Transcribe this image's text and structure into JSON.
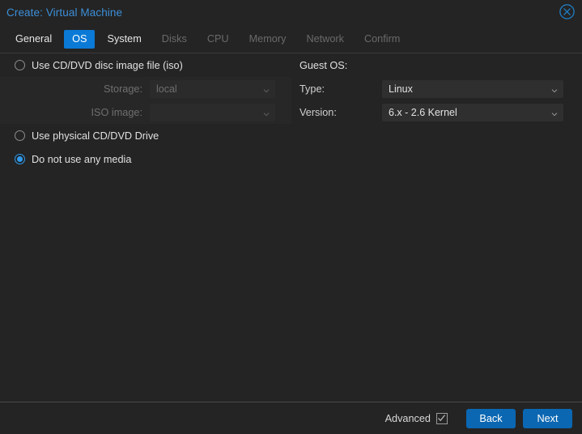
{
  "window": {
    "title": "Create: Virtual Machine",
    "close_icon": "close-circle-icon"
  },
  "tabs": [
    {
      "label": "General",
      "state": "enabled"
    },
    {
      "label": "OS",
      "state": "active"
    },
    {
      "label": "System",
      "state": "enabled"
    },
    {
      "label": "Disks",
      "state": "disabled"
    },
    {
      "label": "CPU",
      "state": "disabled"
    },
    {
      "label": "Memory",
      "state": "disabled"
    },
    {
      "label": "Network",
      "state": "disabled"
    },
    {
      "label": "Confirm",
      "state": "disabled"
    }
  ],
  "media": {
    "option_iso": "Use CD/DVD disc image file (iso)",
    "option_physical": "Use physical CD/DVD Drive",
    "option_none": "Do not use any media",
    "selected": "none",
    "storage_label": "Storage:",
    "storage_value": "local",
    "iso_label": "ISO image:",
    "iso_value": "",
    "chevron_icon": "chevron-down-icon"
  },
  "guest_os": {
    "heading": "Guest OS:",
    "type_label": "Type:",
    "type_value": "Linux",
    "version_label": "Version:",
    "version_value": "6.x - 2.6 Kernel",
    "chevron_icon": "chevron-down-icon"
  },
  "footer": {
    "advanced_label": "Advanced",
    "advanced_checked": true,
    "check_icon": "check-mark-icon",
    "back_label": "Back",
    "next_label": "Next"
  },
  "colors": {
    "accent": "#0a7ad6",
    "title": "#3c8fd8",
    "button": "#0b67b2",
    "background": "#242424"
  }
}
